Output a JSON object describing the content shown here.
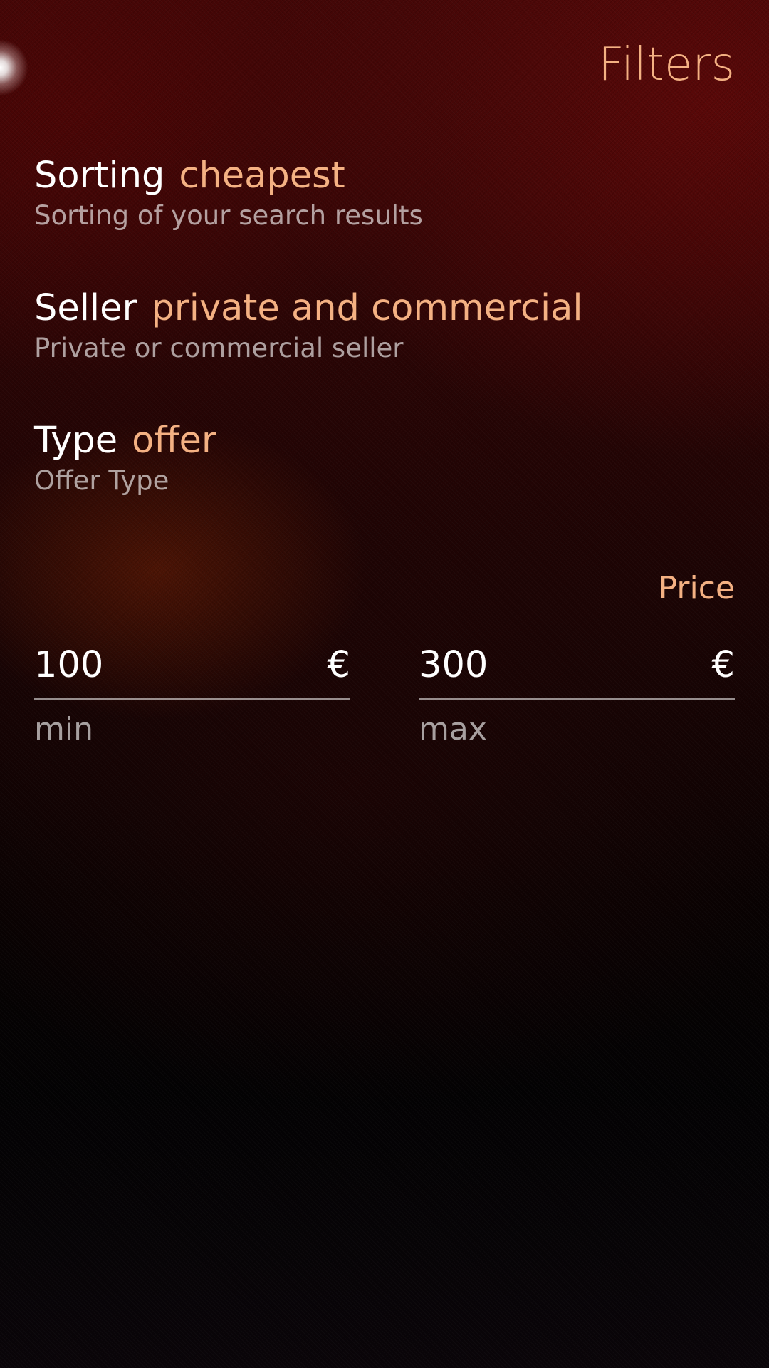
{
  "header": {
    "title": "Filters"
  },
  "filters": [
    {
      "label": "Sorting",
      "value": "cheapest",
      "description": "Sorting of your search results"
    },
    {
      "label": "Seller",
      "value": "private and commercial",
      "description": "Private or commercial seller"
    },
    {
      "label": "Type",
      "value": "offer",
      "description": "Offer Type"
    }
  ],
  "price": {
    "section_title": "Price",
    "min": {
      "value": "100",
      "currency": "€",
      "label": "min"
    },
    "max": {
      "value": "300",
      "currency": "€",
      "label": "max"
    }
  },
  "colors": {
    "accent": "#f4b183",
    "primary_text": "#ffffff",
    "secondary_text": "#a89f9f"
  }
}
